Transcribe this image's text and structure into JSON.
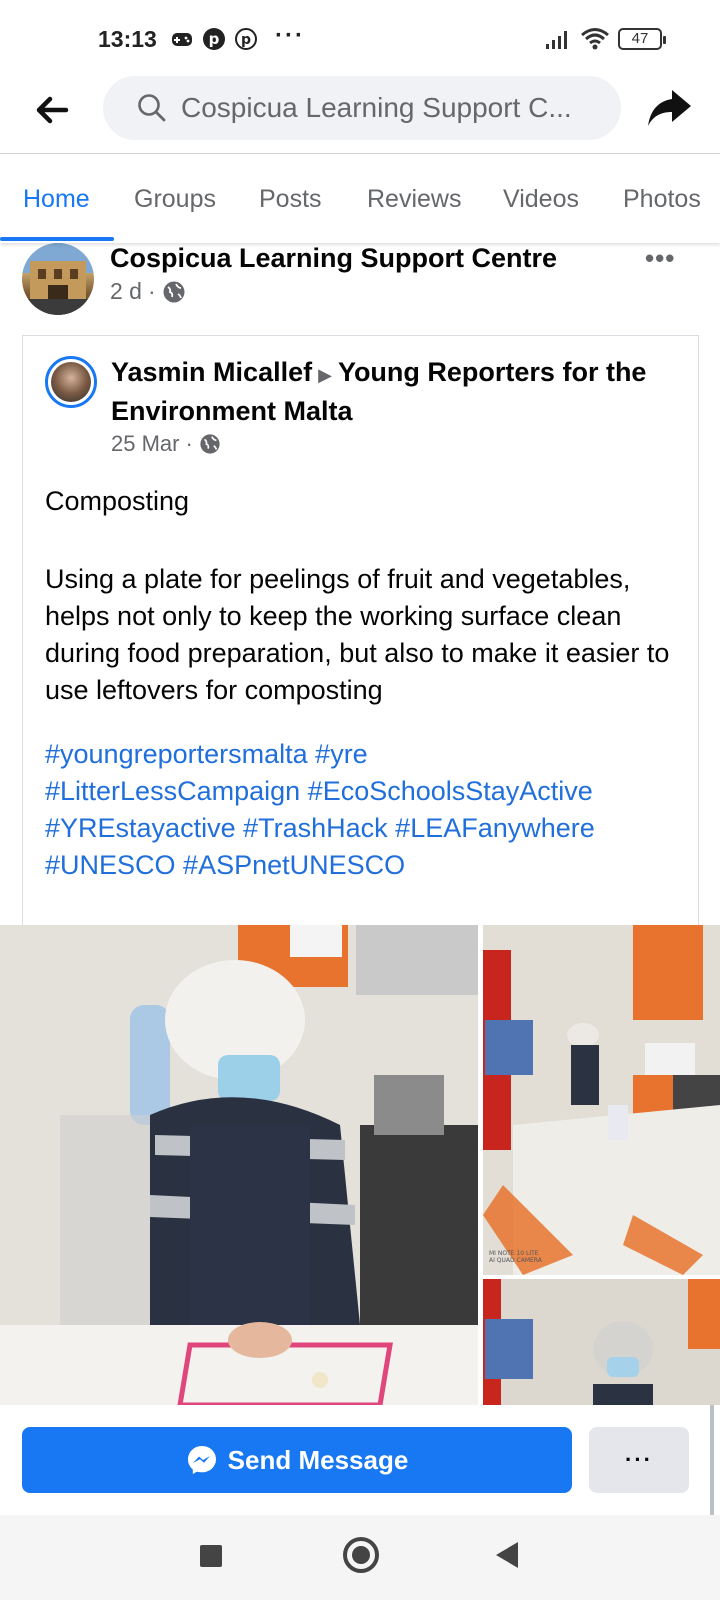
{
  "status_bar": {
    "time": "13:13",
    "extra": "···",
    "battery": "47",
    "icons": [
      "gamepad-icon",
      "pinterest-icon",
      "pinterest-icon",
      "signal-icon",
      "wifi-icon",
      "battery-icon"
    ]
  },
  "top_nav": {
    "search_value": "Cospicua Learning Support C...",
    "icons": [
      "back-arrow-icon",
      "search-icon",
      "share-icon"
    ]
  },
  "tabs": [
    "Home",
    "Groups",
    "Posts",
    "Reviews",
    "Videos",
    "Photos"
  ],
  "active_tab": "Home",
  "post": {
    "page_name": "Cospicua Learning Support Centre",
    "time": "2 d",
    "separator": "·",
    "more": "•••"
  },
  "shared_post": {
    "author": "Yasmin Micallef",
    "arrow": "▶",
    "group": "Young Reporters for the Environment Malta",
    "date": "25 Mar",
    "separator": "·",
    "title": "Composting",
    "body": "Using a plate for peelings of fruit and vegetables, helps not only to keep the working surface clean during food preparation, but also to make it easier to use leftovers for composting",
    "hashtags": [
      "#youngreportersmalta",
      "#yre",
      "#LitterLessCampaign",
      "#EcoSchoolsStayActive",
      "#YREstayactive",
      "#TrashHack",
      "#LEAFanywhere",
      "#UNESCO",
      "#ASPnetUNESCO"
    ],
    "photo_watermark": "MI NOTE 10 LITE\nAI QUAD CAMERA"
  },
  "cta": {
    "send_label": "Send Message",
    "more": "···"
  },
  "colors": {
    "accent": "#1877f2",
    "hashtag": "#216fdb",
    "secondary_text": "#65676b",
    "button_grey": "#e4e6eb"
  }
}
